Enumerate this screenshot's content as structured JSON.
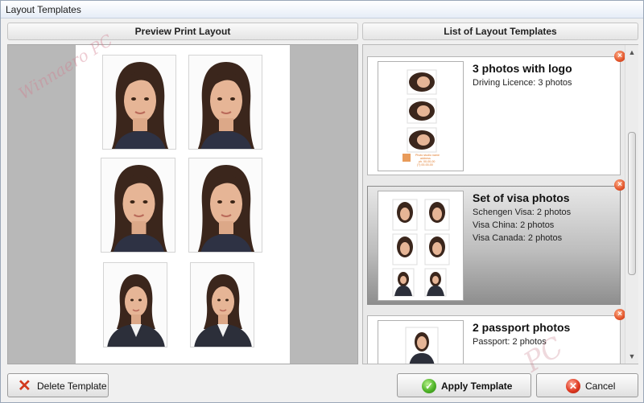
{
  "window": {
    "title": "Layout Templates"
  },
  "preview": {
    "header": "Preview Print Layout"
  },
  "list": {
    "header": "List of Layout Templates",
    "templates": [
      {
        "title": "3 photos with logo",
        "lines": [
          "Driving Licence: 3 photos"
        ],
        "thumb_caption": "Photo studio name\naddress\nph. 00-00-00\n(?) 00-00-00"
      },
      {
        "title": "Set of visa photos",
        "lines": [
          "Schengen Visa: 2 photos",
          "Visa China: 2 photos",
          "Visa Canada: 2 photos"
        ],
        "selected": true
      },
      {
        "title": "2 passport photos",
        "lines": [
          "Passport: 2 photos"
        ]
      }
    ]
  },
  "buttons": {
    "delete": "Delete Template",
    "apply": "Apply Template",
    "cancel": "Cancel"
  },
  "watermark": {
    "text": "Winnaero PC",
    "big": "PC"
  },
  "colors": {
    "accent_remove": "#e2542a",
    "apply_icon": "#4fb428",
    "cancel_icon": "#e03a22",
    "selected_card": "#9a9a9a"
  }
}
